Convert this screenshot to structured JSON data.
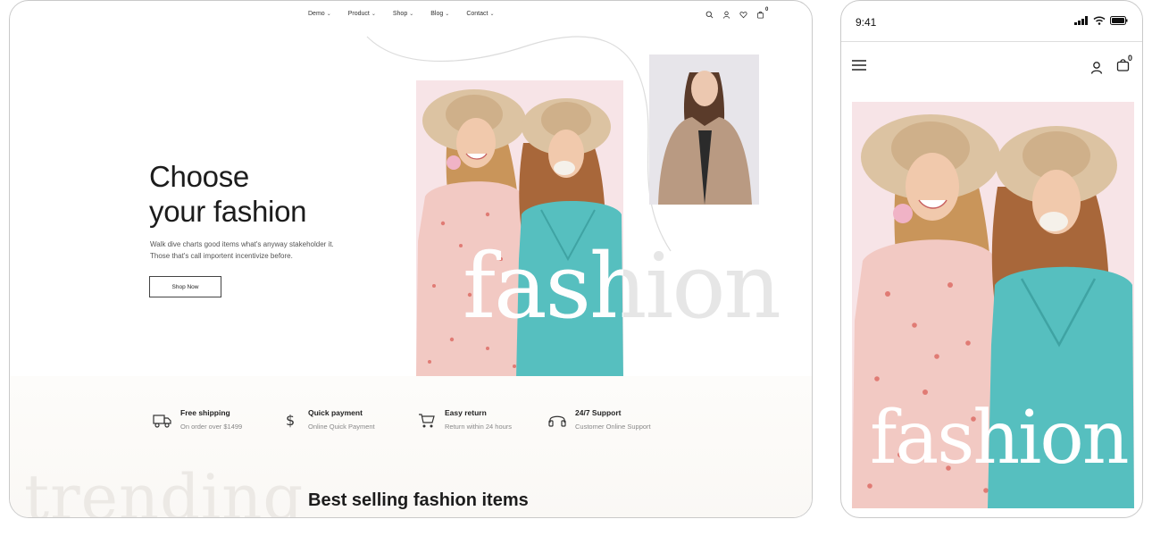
{
  "desktop": {
    "nav": {
      "items": [
        {
          "label": "Demo"
        },
        {
          "label": "Product"
        },
        {
          "label": "Shop"
        },
        {
          "label": "Blog"
        },
        {
          "label": "Contact"
        }
      ],
      "cart_count": "0"
    },
    "hero": {
      "title_line1": "Choose",
      "title_line2": "your fashion",
      "text_line1": "Walk dive charts good items what's anyway stakeholder it.",
      "text_line2": "Those that's call importent incentivize before.",
      "button_label": "Shop Now",
      "overlay_word": "fashion"
    },
    "features": [
      {
        "icon": "truck-icon",
        "title": "Free shipping",
        "subtitle": "On order over $1499"
      },
      {
        "icon": "dollar-icon",
        "title": "Quick payment",
        "subtitle": "Online Quick Payment"
      },
      {
        "icon": "cart-icon",
        "title": "Easy return",
        "subtitle": "Return within 24 hours"
      },
      {
        "icon": "headphones-icon",
        "title": "24/7 Support",
        "subtitle": "Customer Online Support"
      }
    ],
    "trending_word": "trending",
    "section_title": "Best selling fashion items"
  },
  "mobile": {
    "status_time": "9:41",
    "cart_count": "0",
    "overlay_word": "fashion"
  },
  "colors": {
    "dress_floral": "#f2c9c3",
    "dress_teal": "#56bfbf",
    "photo_bg": "#f7e3e6",
    "text_dark": "#1c1c1c"
  }
}
